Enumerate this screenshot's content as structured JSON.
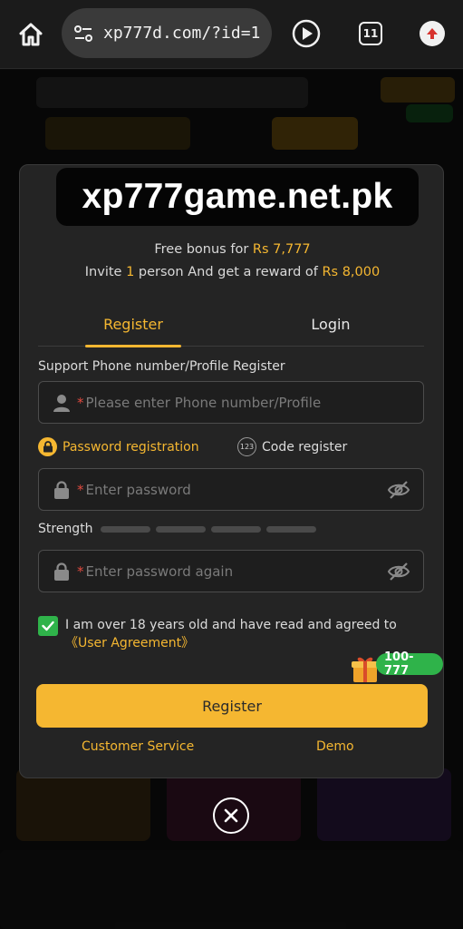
{
  "browser": {
    "url": "xp777d.com/?id=1",
    "tab_count": "11"
  },
  "modal": {
    "banner_text": "xp777game.net.pk",
    "promo_line1_prefix": "Free bonus for ",
    "promo_line1_amount": "Rs 7,777",
    "promo_line2_prefix": "Invite ",
    "promo_line2_count": "1",
    "promo_line2_middle": " person And get a reward of ",
    "promo_line2_amount": "Rs 8,000",
    "tabs": [
      {
        "label": "Register",
        "active": true
      },
      {
        "label": "Login",
        "active": false
      }
    ],
    "phone_label": "Support Phone number/Profile Register",
    "phone_placeholder": "Please enter Phone number/Profile",
    "required_mark": "*",
    "reg_type_password": "Password registration",
    "reg_type_code_icon": "123",
    "reg_type_code": "Code register",
    "password_placeholder": "Enter password",
    "strength_label": "Strength",
    "password_again_placeholder": "Enter password again",
    "agree_text": "I am over 18 years old and have read and agreed to ",
    "agree_link": "《User Agreement》",
    "agree_checked": true,
    "gift_badge": "100-777",
    "register_button": "Register",
    "customer_service": "Customer Service",
    "demo": "Demo"
  },
  "icons": {
    "home": "home-icon",
    "url_settings": "tune-icon",
    "play": "play-icon",
    "tabs": "tab-count-icon",
    "update": "update-arrow-icon",
    "user": "user-icon",
    "lock": "lock-icon",
    "eye_off": "eye-off-icon",
    "gift": "gift-icon",
    "close": "close-icon"
  },
  "colors": {
    "accent": "#f5b731",
    "success": "#2fb34a",
    "required": "#e04a3f",
    "modal_bg": "#242424"
  }
}
